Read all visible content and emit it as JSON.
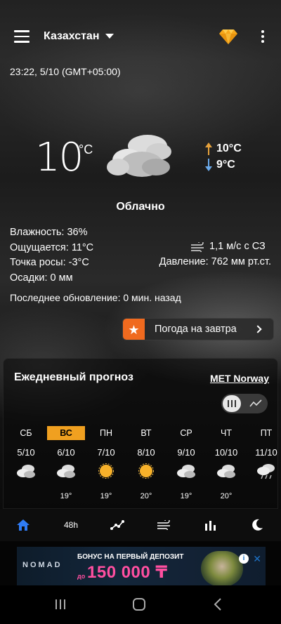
{
  "topbar": {
    "location": "Казахстан",
    "menu_icon": "hamburger-menu-icon",
    "premium_icon": "diamond-icon",
    "more_icon": "more-vertical-icon"
  },
  "current": {
    "datetime": "23:22, 5/10 (GMT+05:00)",
    "temperature": "10",
    "unit": "°C",
    "high": "10°C",
    "low": "9°C",
    "condition": "Облачно",
    "humidity": "Влажность: 36%",
    "feels_like": "Ощущается: 11°C",
    "dew_point": "Точка росы: -3°C",
    "precipitation": "Осадки: 0 мм",
    "wind": "1,1 м/с с СЗ",
    "pressure": "Давление: 762 мм рт.ст.",
    "last_update": "Последнее обновление: 0 мин. назад",
    "tomorrow_button": "Погода на завтра"
  },
  "forecast": {
    "title": "Ежедневный прогноз",
    "source": "MET Norway",
    "days": [
      {
        "name": "СБ",
        "date": "5/10",
        "icon": "cloudy-icon",
        "temp": "",
        "active": false
      },
      {
        "name": "ВС",
        "date": "6/10",
        "icon": "cloudy-icon",
        "temp": "19°",
        "active": true
      },
      {
        "name": "ПН",
        "date": "7/10",
        "icon": "sunny-icon",
        "temp": "19°",
        "active": false
      },
      {
        "name": "ВТ",
        "date": "8/10",
        "icon": "sunny-icon",
        "temp": "20°",
        "active": false
      },
      {
        "name": "СР",
        "date": "9/10",
        "icon": "cloudy-icon",
        "temp": "19°",
        "active": false
      },
      {
        "name": "ЧТ",
        "date": "10/10",
        "icon": "cloudy-icon",
        "temp": "20°",
        "active": false
      },
      {
        "name": "ПТ",
        "date": "11/10",
        "icon": "rain-icon",
        "temp": "",
        "active": false
      }
    ]
  },
  "bottom_nav": {
    "home_icon": "home-icon",
    "hourly_label": "48h",
    "graph_icon": "graph-icon",
    "wind_icon": "wind-icon",
    "chart_icon": "bar-chart-icon",
    "moon_icon": "moon-icon"
  },
  "ad": {
    "brand": "NOMAD",
    "headline": "БОНУС НА ПЕРВЫЙ ДЕПОЗИТ",
    "prefix": "до",
    "amount": "150 000 ₸"
  },
  "colors": {
    "accent": "#f0a020",
    "star_bg": "#f06a1f",
    "high_arrow": "#e6a23c",
    "low_arrow": "#6aa9e9",
    "home_active": "#2f7cf6"
  }
}
